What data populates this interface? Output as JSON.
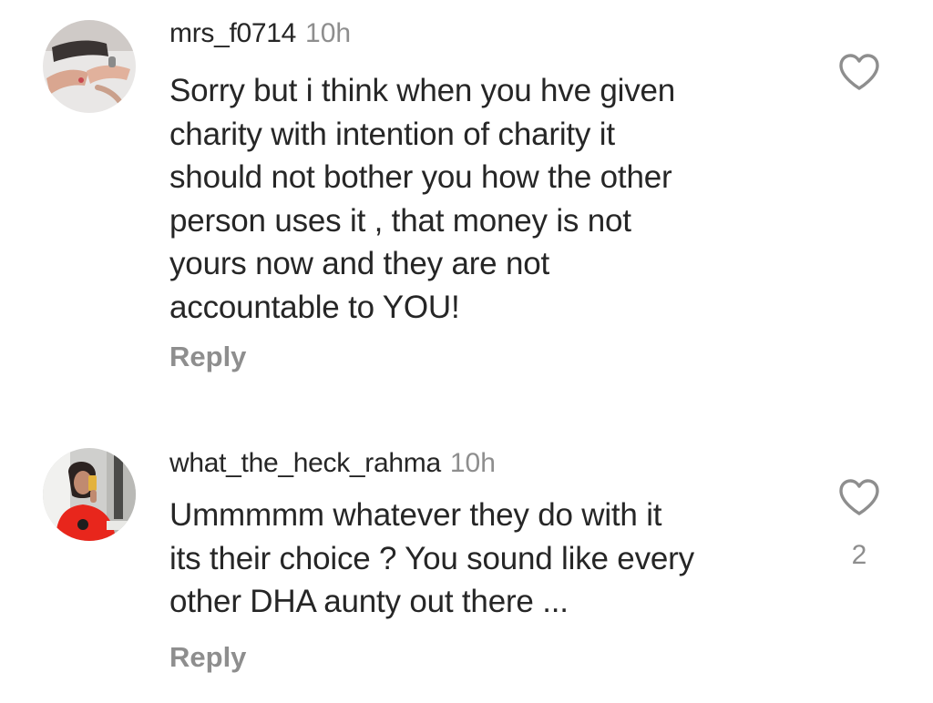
{
  "comments": [
    {
      "username": "mrs_f0714",
      "time": "10h",
      "text": "Sorry but i think when you hve given\ncharity with intention of charity it\nshould not bother you how the other\nperson uses it , that money is not\nyours now and they are not\naccountable to YOU!",
      "reply_label": "Reply",
      "avatar_icon": "avatar-hands-photo",
      "like_icon": "heart-outline-icon"
    },
    {
      "username": "what_the_heck_rahma",
      "time": "10h",
      "text": "Ummmmm whatever they do with it\nits their choice ? You sound like every\nother DHA aunty out there ...",
      "reply_label": "Reply",
      "like_count": "2",
      "avatar_icon": "avatar-mirror-selfie-photo",
      "like_icon": "heart-outline-icon"
    }
  ],
  "colors": {
    "primary_text": "#262626",
    "secondary_text": "#8e8e8e",
    "background": "#ffffff",
    "avatar2_shirt": "#e8261c"
  }
}
